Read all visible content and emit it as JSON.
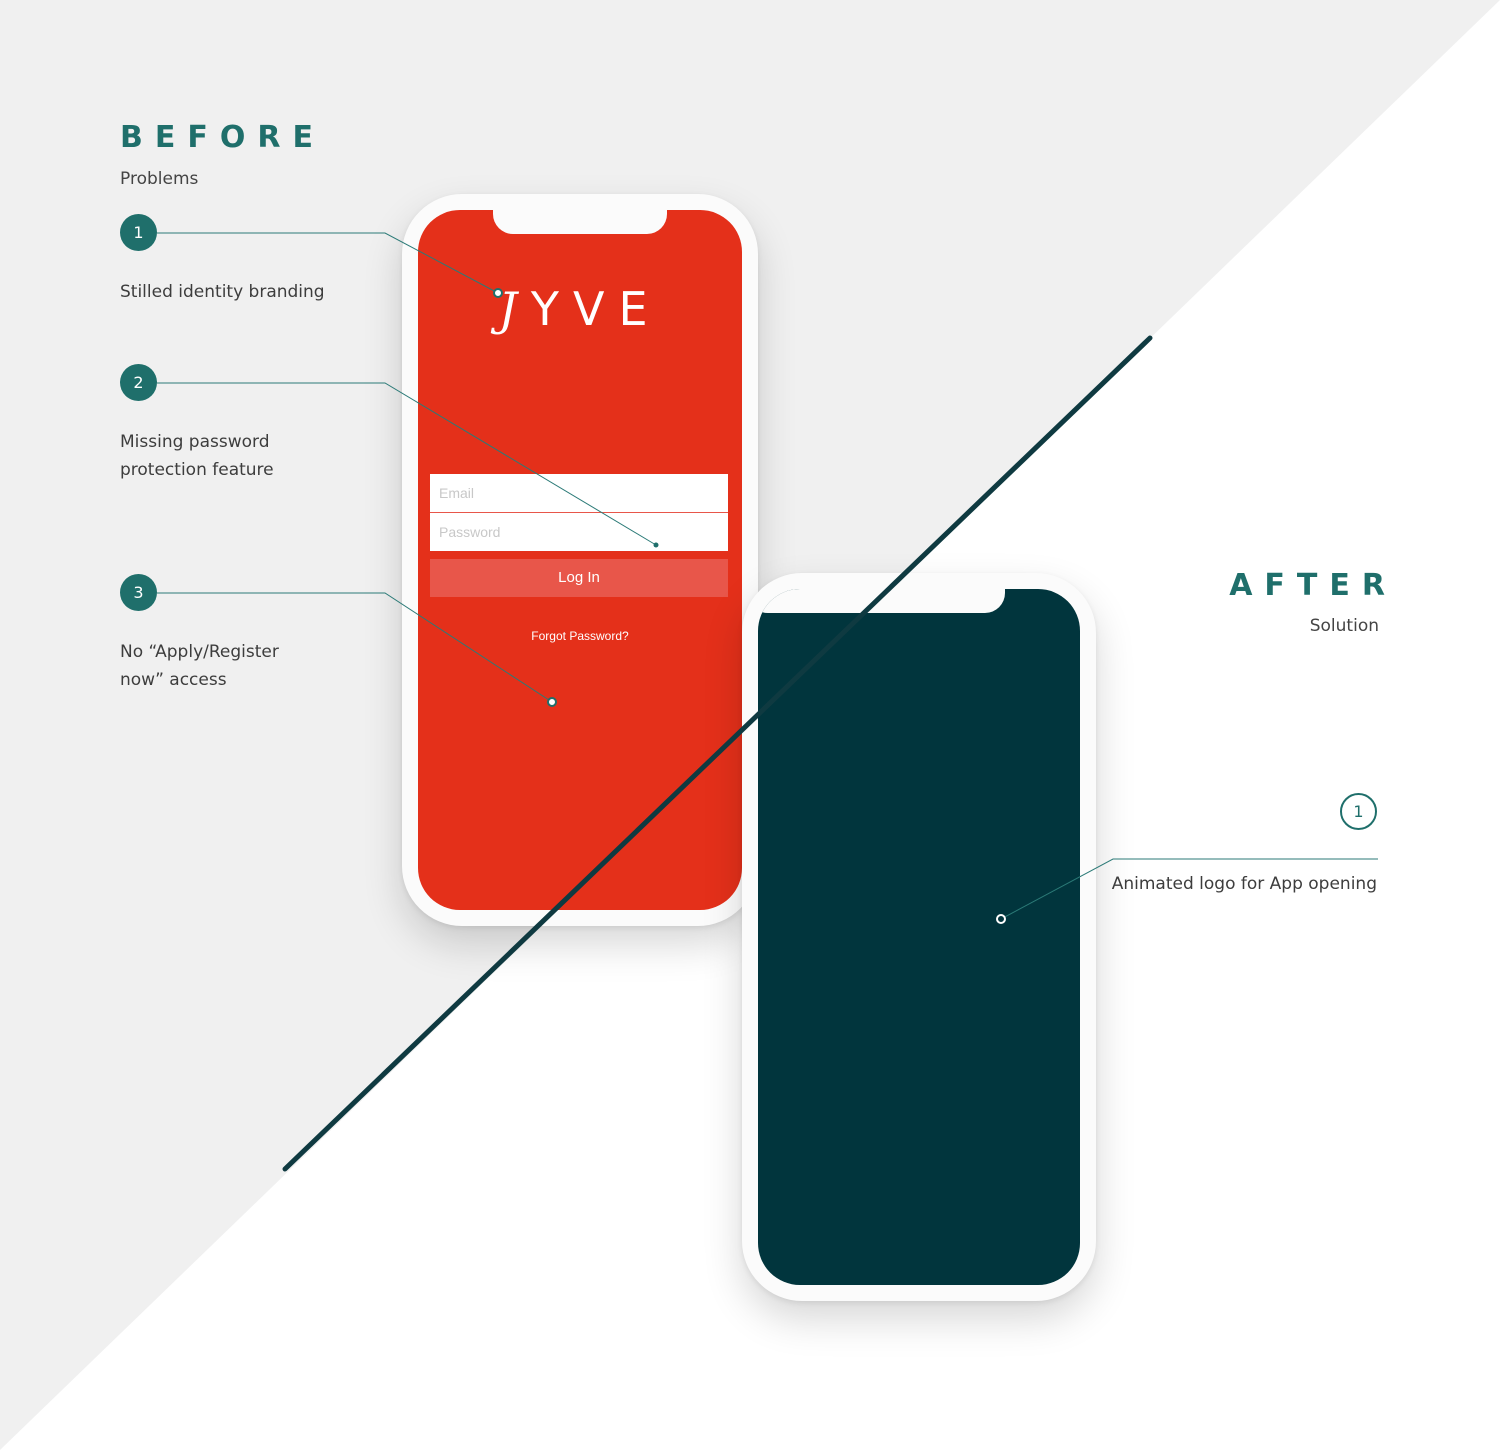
{
  "before": {
    "title": "BEFORE",
    "subtitle": "Problems",
    "problems": [
      {
        "number": "1",
        "text": "Stilled identity branding"
      },
      {
        "number": "2",
        "text": "Missing password protection feature"
      },
      {
        "number": "3",
        "text": "No “Apply/Register now” access"
      }
    ]
  },
  "after": {
    "title": "AFTER",
    "subtitle": "Solution",
    "solutions": [
      {
        "number": "1",
        "text": "Animated logo for App opening"
      }
    ]
  },
  "old_app": {
    "logo_swash": "J",
    "logo_text": "YVE",
    "email_placeholder": "Email",
    "password_placeholder": "Password",
    "login_label": "Log In",
    "forgot_label": "Forgot Password?"
  },
  "colors": {
    "accent_teal": "#1f6f6b",
    "brand_red": "#e4301a",
    "new_app_background": "#01353d",
    "divider_line": "#0f3a41",
    "page_gray": "#f0f0f0"
  }
}
